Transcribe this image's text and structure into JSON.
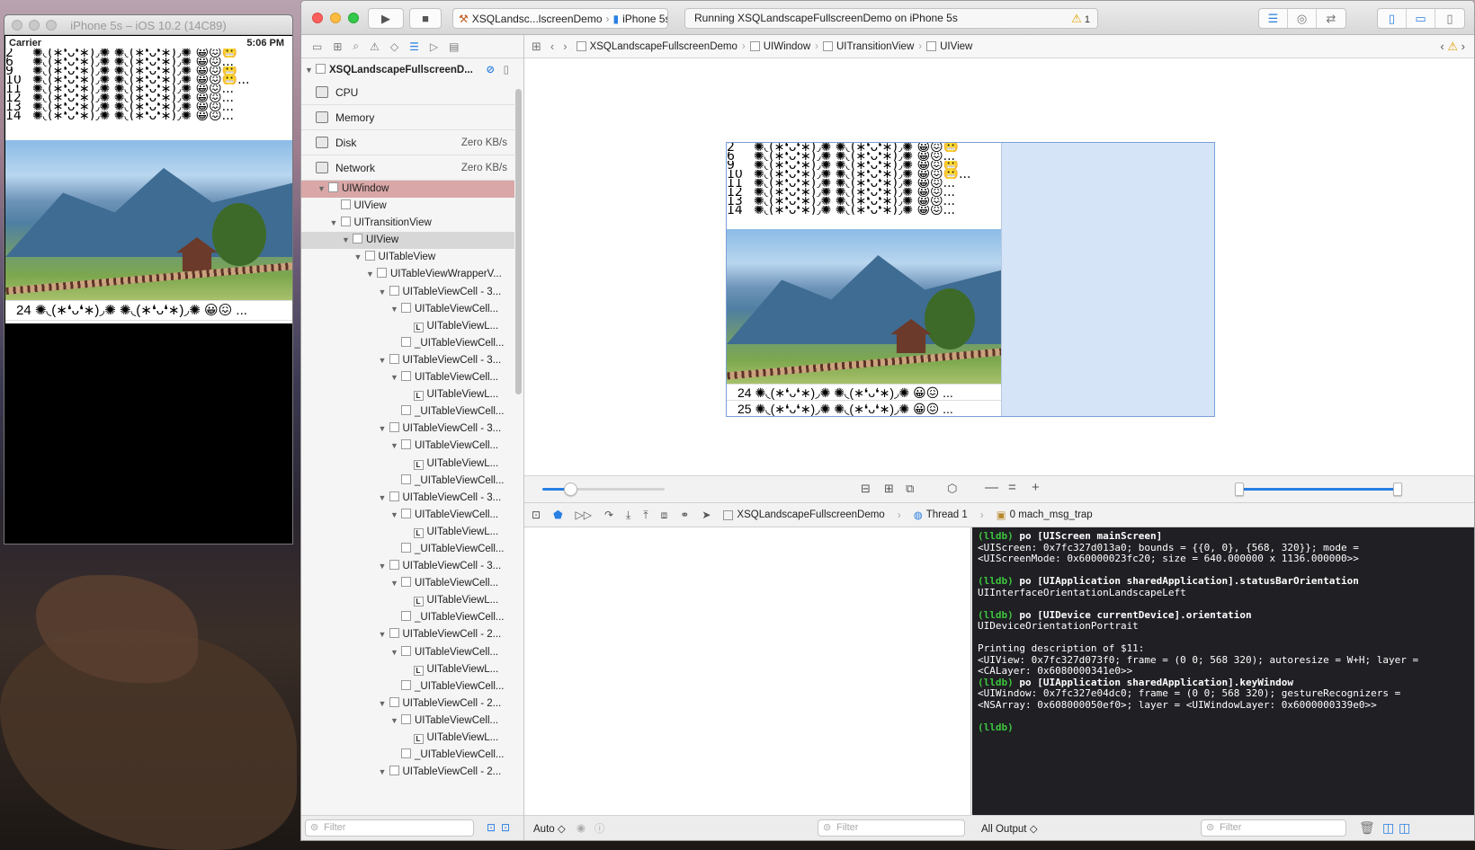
{
  "simulator": {
    "title": "iPhone 5s – iOS 10.2 (14C89)",
    "carrier": "Carrier",
    "time": "5:06 PM",
    "rows": [
      {
        "n": "2",
        "text": "✺◟(∗❛ᴗ❛∗)◞✺ ✺◟(∗❛ᴗ❛∗)◞✺ 😀😖😬"
      },
      {
        "n": "6",
        "text": "✺◟(∗❛ᴗ❛∗)◞✺ ✺◟(∗❛ᴗ❛∗)◞✺ 😀😖..."
      },
      {
        "n": "9",
        "text": "✺◟(∗❛ᴗ❛∗)◞✺ ✺◟(∗❛ᴗ❛∗)◞✺ 😀😖😬"
      },
      {
        "n": "10",
        "text": "✺◟(∗❛ᴗ❛∗)◞✺ ✺◟(∗❛ᴗ❛∗)◞✺ 😀😖😬..."
      },
      {
        "n": "11",
        "text": "✺◟(∗❛ᴗ❛∗)◞✺ ✺◟(∗❛ᴗ❛∗)◞✺ 😀😖..."
      },
      {
        "n": "12",
        "text": "✺◟(∗❛ᴗ❛∗)◞✺ ✺◟(∗❛ᴗ❛∗)◞✺ 😀😖..."
      },
      {
        "n": "13",
        "text": "✺◟(∗❛ᴗ❛∗)◞✺ ✺◟(∗❛ᴗ❛∗)◞✺ 😀😖..."
      },
      {
        "n": "14",
        "text": "✺◟(∗❛ᴗ❛∗)◞✺ ✺◟(∗❛ᴗ❛∗)◞✺ 😀😖..."
      }
    ],
    "bottom_rows": [
      {
        "n": "24",
        "text": "✺◟(∗❛ᴗ❛∗)◞✺ ✺◟(∗❛ᴗ❛∗)◞✺ 😀😖 ..."
      },
      {
        "n": "25",
        "text": "✺◟(∗❛ᴗ❛∗)◞✺ ✺◟(∗❛ᴗ❛∗)◞✺ 😀😖 ..."
      }
    ]
  },
  "xcode": {
    "scheme_project": "XSQLandsc...lscreenDemo",
    "scheme_device": "iPhone 5s",
    "activity": "Running XSQLandscapeFullscreenDemo on iPhone 5s",
    "warning_count": "1",
    "navigator": {
      "project": "XSQLandscapeFullscreenD...",
      "gauges": [
        {
          "label": "CPU",
          "value": ""
        },
        {
          "label": "Memory",
          "value": ""
        },
        {
          "label": "Disk",
          "value": "Zero KB/s"
        },
        {
          "label": "Network",
          "value": "Zero KB/s"
        }
      ],
      "tree": [
        {
          "indent": 0,
          "disc": "▼",
          "label": "UIWindow",
          "box": "",
          "state": "win"
        },
        {
          "indent": 1,
          "disc": "",
          "label": "UIView",
          "box": "",
          "state": ""
        },
        {
          "indent": 1,
          "disc": "▼",
          "label": "UITransitionView",
          "box": "",
          "state": ""
        },
        {
          "indent": 2,
          "disc": "▼",
          "label": "UIView",
          "box": "",
          "state": "sel"
        },
        {
          "indent": 3,
          "disc": "▼",
          "label": "UITableView",
          "box": "",
          "state": ""
        },
        {
          "indent": 4,
          "disc": "▼",
          "label": "UITableViewWrapperV...",
          "box": "",
          "state": ""
        },
        {
          "indent": 5,
          "disc": "▼",
          "label": "UITableViewCell - 3...",
          "box": "",
          "state": ""
        },
        {
          "indent": 6,
          "disc": "▼",
          "label": "UITableViewCell...",
          "box": "",
          "state": ""
        },
        {
          "indent": 7,
          "disc": "",
          "label": "UITableViewL...",
          "box": "L",
          "state": ""
        },
        {
          "indent": 6,
          "disc": "",
          "label": "_UITableViewCell...",
          "box": "",
          "state": ""
        },
        {
          "indent": 5,
          "disc": "▼",
          "label": "UITableViewCell - 3...",
          "box": "",
          "state": ""
        },
        {
          "indent": 6,
          "disc": "▼",
          "label": "UITableViewCell...",
          "box": "",
          "state": ""
        },
        {
          "indent": 7,
          "disc": "",
          "label": "UITableViewL...",
          "box": "L",
          "state": ""
        },
        {
          "indent": 6,
          "disc": "",
          "label": "_UITableViewCell...",
          "box": "",
          "state": ""
        },
        {
          "indent": 5,
          "disc": "▼",
          "label": "UITableViewCell - 3...",
          "box": "",
          "state": ""
        },
        {
          "indent": 6,
          "disc": "▼",
          "label": "UITableViewCell...",
          "box": "",
          "state": ""
        },
        {
          "indent": 7,
          "disc": "",
          "label": "UITableViewL...",
          "box": "L",
          "state": ""
        },
        {
          "indent": 6,
          "disc": "",
          "label": "_UITableViewCell...",
          "box": "",
          "state": ""
        },
        {
          "indent": 5,
          "disc": "▼",
          "label": "UITableViewCell - 3...",
          "box": "",
          "state": ""
        },
        {
          "indent": 6,
          "disc": "▼",
          "label": "UITableViewCell...",
          "box": "",
          "state": ""
        },
        {
          "indent": 7,
          "disc": "",
          "label": "UITableViewL...",
          "box": "L",
          "state": ""
        },
        {
          "indent": 6,
          "disc": "",
          "label": "_UITableViewCell...",
          "box": "",
          "state": ""
        },
        {
          "indent": 5,
          "disc": "▼",
          "label": "UITableViewCell - 3...",
          "box": "",
          "state": ""
        },
        {
          "indent": 6,
          "disc": "▼",
          "label": "UITableViewCell...",
          "box": "",
          "state": ""
        },
        {
          "indent": 7,
          "disc": "",
          "label": "UITableViewL...",
          "box": "L",
          "state": ""
        },
        {
          "indent": 6,
          "disc": "",
          "label": "_UITableViewCell...",
          "box": "",
          "state": ""
        },
        {
          "indent": 5,
          "disc": "▼",
          "label": "UITableViewCell - 2...",
          "box": "",
          "state": ""
        },
        {
          "indent": 6,
          "disc": "▼",
          "label": "UITableViewCell...",
          "box": "",
          "state": ""
        },
        {
          "indent": 7,
          "disc": "",
          "label": "UITableViewL...",
          "box": "L",
          "state": ""
        },
        {
          "indent": 6,
          "disc": "",
          "label": "_UITableViewCell...",
          "box": "",
          "state": ""
        },
        {
          "indent": 5,
          "disc": "▼",
          "label": "UITableViewCell - 2...",
          "box": "",
          "state": ""
        },
        {
          "indent": 6,
          "disc": "▼",
          "label": "UITableViewCell...",
          "box": "",
          "state": ""
        },
        {
          "indent": 7,
          "disc": "",
          "label": "UITableViewL...",
          "box": "L",
          "state": ""
        },
        {
          "indent": 6,
          "disc": "",
          "label": "_UITableViewCell...",
          "box": "",
          "state": ""
        },
        {
          "indent": 5,
          "disc": "▼",
          "label": "UITableViewCell - 2...",
          "box": "",
          "state": ""
        }
      ],
      "filter_placeholder": "Filter"
    },
    "jumpbar": [
      "XSQLandscapeFullscreenDemo",
      "UIWindow",
      "UITransitionView",
      "UIView"
    ],
    "debug": {
      "crumb_project": "XSQLandscapeFullscreenDemo",
      "crumb_thread": "Thread 1",
      "crumb_frame": "0 mach_msg_trap",
      "vars_mode": "Auto ◇",
      "output_mode": "All Output ◇",
      "filter_placeholder": "Filter"
    },
    "console_lines": [
      {
        "t": "(lldb) ",
        "c": "po [UIScreen mainScreen]",
        "kind": "cmd"
      },
      {
        "t": "<UIScreen: 0x7fc327d013a0; bounds = {{0, 0}, {568, 320}}; mode =",
        "kind": "out"
      },
      {
        "t": "<UIScreenMode: 0x60000023fc20; size = 640.000000 x 1136.000000>>",
        "kind": "out"
      },
      {
        "t": "",
        "kind": "gap"
      },
      {
        "t": "(lldb) ",
        "c": "po [UIApplication sharedApplication].statusBarOrientation",
        "kind": "cmd"
      },
      {
        "t": "UIInterfaceOrientationLandscapeLeft",
        "kind": "out"
      },
      {
        "t": "",
        "kind": "gap"
      },
      {
        "t": "(lldb) ",
        "c": "po [UIDevice currentDevice].orientation",
        "kind": "cmd"
      },
      {
        "t": "UIDeviceOrientationPortrait",
        "kind": "out"
      },
      {
        "t": "",
        "kind": "gap"
      },
      {
        "t": "Printing description of $11:",
        "kind": "out"
      },
      {
        "t": "<UIView: 0x7fc327d073f0; frame = (0 0; 568 320); autoresize = W+H; layer =",
        "kind": "out"
      },
      {
        "t": "<CALayer: 0x6080000341e0>>",
        "kind": "out"
      },
      {
        "t": "(lldb) ",
        "c": "po [UIApplication sharedApplication].keyWindow",
        "kind": "cmd"
      },
      {
        "t": "<UIWindow: 0x7fc327e04dc0; frame = (0 0; 568 320); gestureRecognizers =",
        "kind": "out"
      },
      {
        "t": "<NSArray: 0x608000050ef0>; layer = <UIWindowLayer: 0x6000000339e0>>",
        "kind": "out"
      },
      {
        "t": "",
        "kind": "gap"
      },
      {
        "t": "(lldb)",
        "c": "",
        "kind": "cmd"
      }
    ]
  }
}
